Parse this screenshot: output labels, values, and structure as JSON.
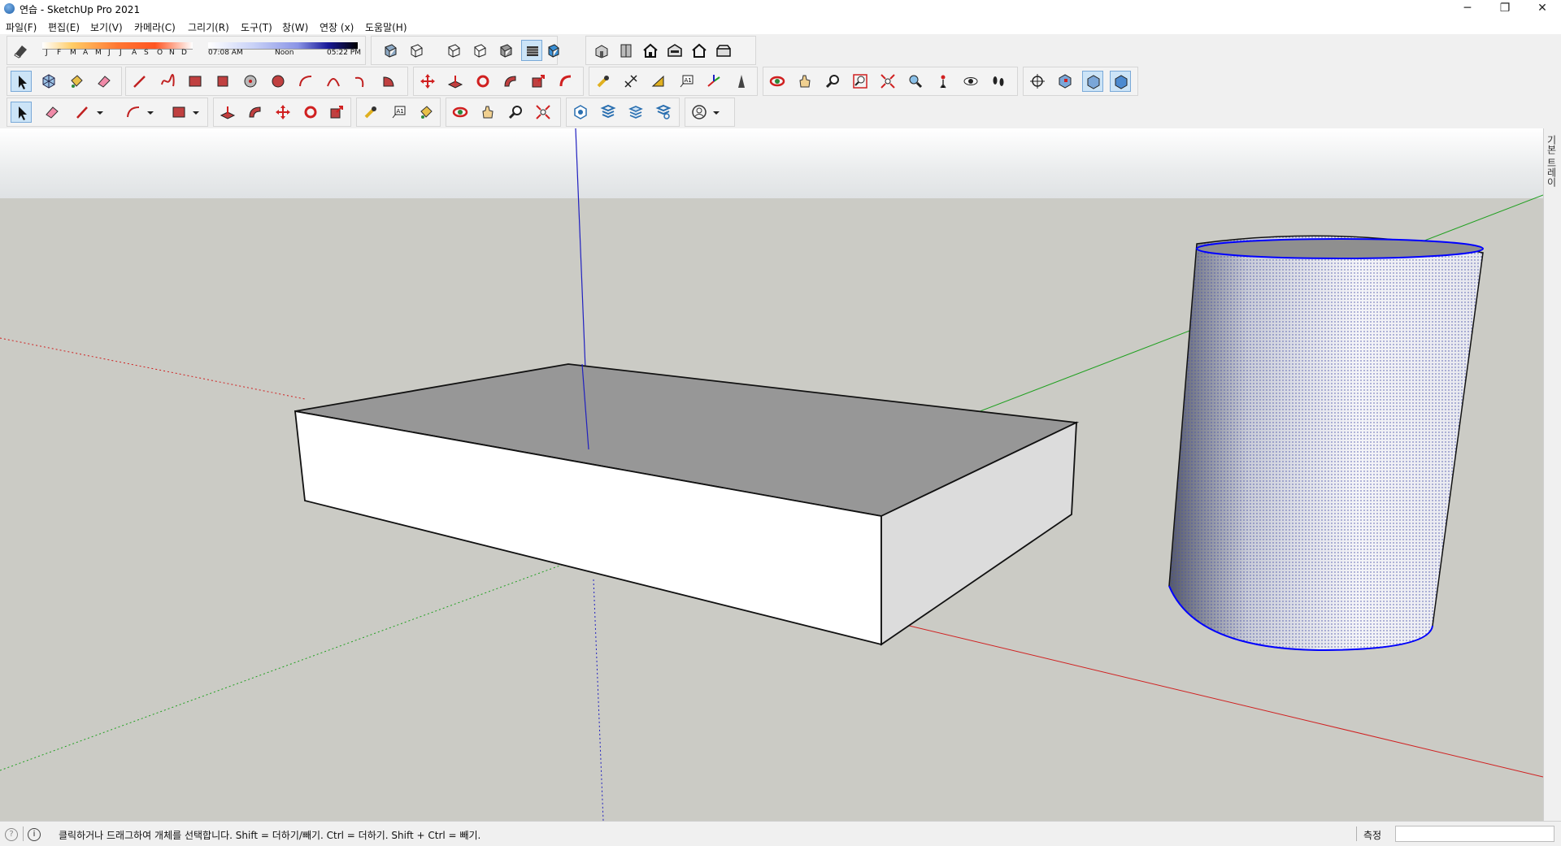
{
  "window": {
    "title": "연습 - SketchUp Pro 2021",
    "minimize": "─",
    "restore": "❐",
    "close": "✕"
  },
  "menu": [
    "파일(F)",
    "편집(E)",
    "보기(V)",
    "카메라(C)",
    "그리기(R)",
    "도구(T)",
    "창(W)",
    "연장 (x)",
    "도움말(H)"
  ],
  "shadow": {
    "months": [
      "J",
      "F",
      "M",
      "A",
      "M",
      "J",
      "J",
      "A",
      "S",
      "O",
      "N",
      "D"
    ],
    "time_start": "07:08 AM",
    "time_mid": "Noon",
    "time_end": "05:22 PM"
  },
  "toolbar1": [
    "styles-icon",
    "sun-month-slider",
    "sun-time-slider",
    "xray-icon",
    "back-edges-icon",
    "wireframe-icon",
    "hidden-line-icon",
    "shaded-icon",
    "shaded-texture-icon",
    "monochrome-icon",
    "iso-view-icon",
    "top-view-icon",
    "front-view-icon",
    "right-view-icon",
    "back-view-icon",
    "left-view-icon"
  ],
  "toolbar2": [
    "select-icon",
    "component-icon",
    "paint-bucket-icon",
    "eraser-icon",
    "line-icon",
    "freehand-icon",
    "rectangle-icon",
    "rotated-rectangle-icon",
    "circle-icon",
    "polygon-icon",
    "arc-icon",
    "two-point-arc-icon",
    "three-point-arc-icon",
    "pie-icon",
    "move-icon",
    "push-pull-icon",
    "rotate-icon",
    "follow-me-icon",
    "scale-icon",
    "offset-icon",
    "tape-measure-icon",
    "dimension-icon",
    "protractor-icon",
    "text-icon",
    "axes-icon",
    "3d-text-icon",
    "orbit-icon",
    "pan-icon",
    "zoom-icon",
    "zoom-window-icon",
    "zoom-extents-icon",
    "position-camera-icon",
    "look-around-icon",
    "walk-icon",
    "section-plane-icon",
    "display-section-planes-icon",
    "display-section-cuts-icon",
    "display-section-fill-icon"
  ],
  "toolbar3": [
    "select-icon",
    "eraser-icon",
    "pencil-icon",
    "arc-icon",
    "rectangle-icon",
    "push-pull-icon",
    "follow-me-icon",
    "move-icon",
    "rotate-icon",
    "scale-icon",
    "tape-measure-icon",
    "text-icon",
    "paint-bucket-icon",
    "orbit-icon",
    "pan-icon",
    "zoom-icon",
    "zoom-extents-icon",
    "warehouse-icon",
    "extension-warehouse-icon",
    "layout-icon",
    "extension-manager-icon",
    "account-icon"
  ],
  "tray": {
    "label": "기본 트레이"
  },
  "status": {
    "help_text": "클릭하거나 드래그하여 개체를 선택합니다. Shift = 더하기/빼기. Ctrl = 더하기. Shift + Ctrl = 빼기.",
    "measure_label": "측정",
    "measure_value": ""
  },
  "colors": {
    "x_axis": "#d02020",
    "y_axis": "#20a020",
    "z_axis": "#2020c0",
    "selection": "#0000ff"
  }
}
